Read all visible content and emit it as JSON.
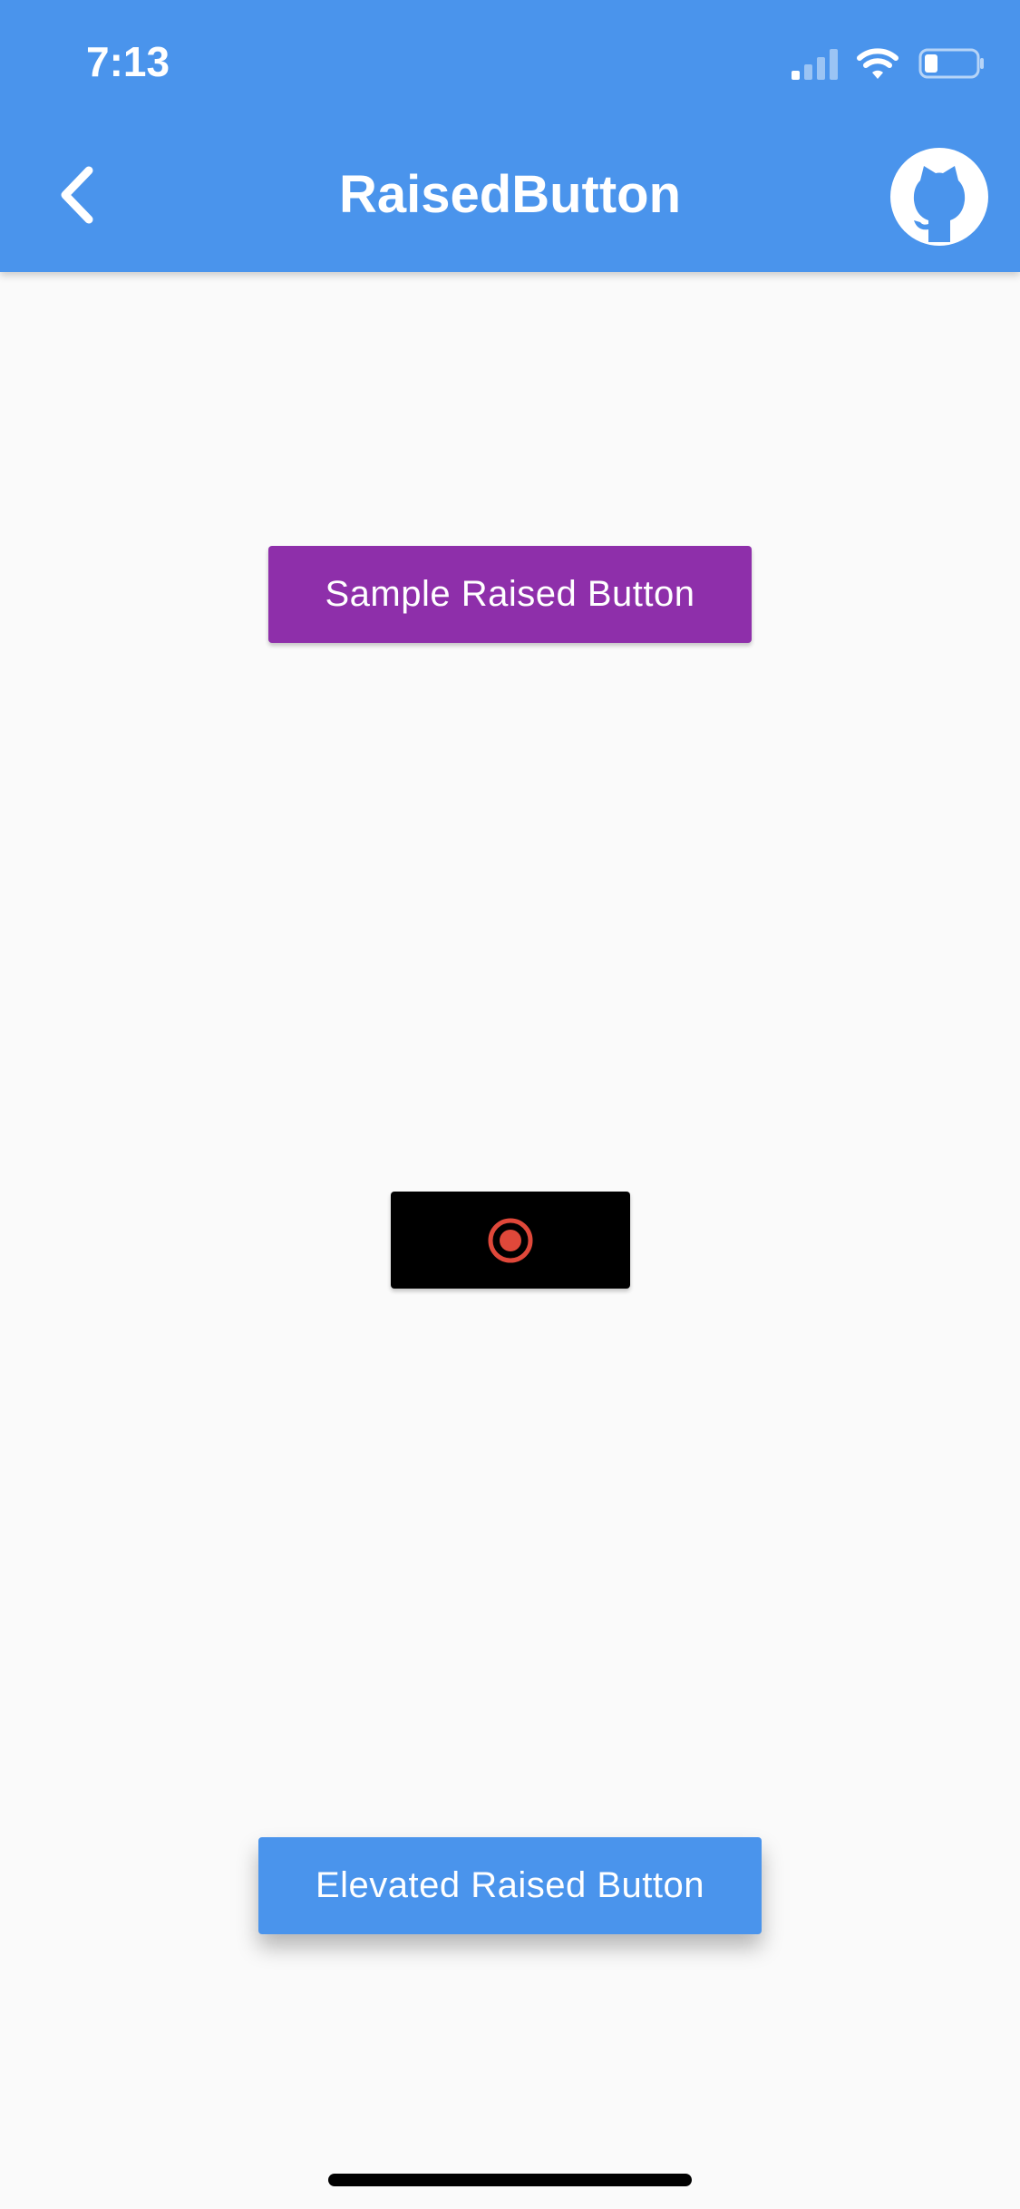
{
  "status_bar": {
    "time": "7:13",
    "icons": [
      "signal-icon",
      "wifi-icon",
      "battery-icon"
    ]
  },
  "app_bar": {
    "title": "RaisedButton",
    "back_icon": "chevron-left-icon",
    "action_icon": "github-icon"
  },
  "buttons": {
    "sample": {
      "label": "Sample Raised Button",
      "color": "#8E2FAA"
    },
    "record": {
      "icon": "record-icon",
      "color": "#000000",
      "icon_color": "#E0483A"
    },
    "elevated": {
      "label": "Elevated Raised Button",
      "color": "#4A94EC"
    }
  },
  "colors": {
    "primary": "#4A94EC",
    "background": "#FAFAFA"
  }
}
